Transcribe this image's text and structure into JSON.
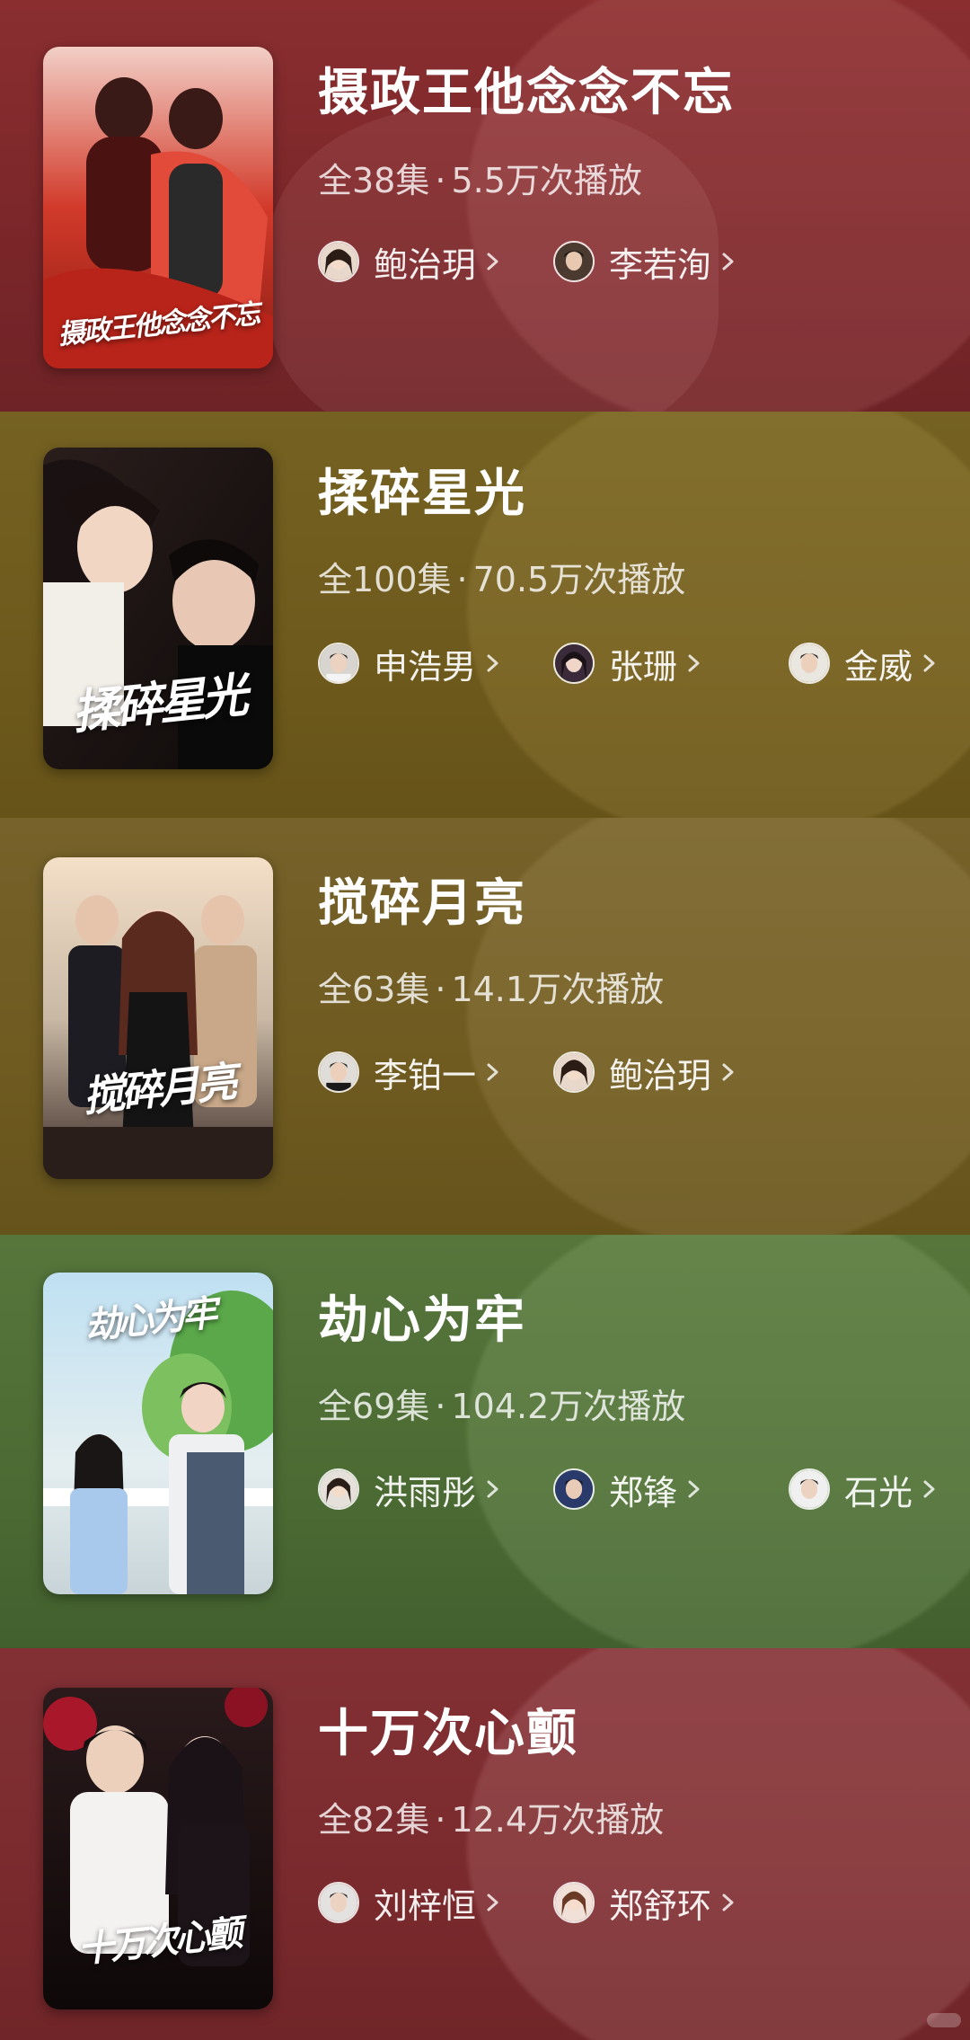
{
  "dramas": [
    {
      "title": "摄政王他念念不忘",
      "episodes": "全38集",
      "separator": "·",
      "plays": "5.5万次播放",
      "poster_text": "摄政王他念念不忘",
      "bg_color": "#7d2a2c",
      "actors": [
        {
          "name": "鲍治玥"
        },
        {
          "name": "李若洵"
        }
      ]
    },
    {
      "title": "揉碎星光",
      "episodes": "全100集",
      "separator": "·",
      "plays": "70.5万次播放",
      "poster_text": "揉碎星光",
      "bg_color": "#6e5a1c",
      "actors": [
        {
          "name": "申浩男"
        },
        {
          "name": "张珊"
        },
        {
          "name": "金威"
        }
      ]
    },
    {
      "title": "搅碎月亮",
      "episodes": "全63集",
      "separator": "·",
      "plays": "14.1万次播放",
      "poster_text": "搅碎月亮",
      "bg_color": "#6f5b20",
      "actors": [
        {
          "name": "李铂一"
        },
        {
          "name": "鲍治玥"
        }
      ]
    },
    {
      "title": "劫心为牢",
      "episodes": "全69集",
      "separator": "·",
      "plays": "104.2万次播放",
      "poster_text": "劫心为牢",
      "bg_color": "#4c6b34",
      "actors": [
        {
          "name": "洪雨彤"
        },
        {
          "name": "郑锋"
        },
        {
          "name": "石光"
        }
      ]
    },
    {
      "title": "十万次心颤",
      "episodes": "全82集",
      "separator": "·",
      "plays": "12.4万次播放",
      "poster_text": "十万次心颤",
      "bg_color": "#7a2a2d",
      "actors": [
        {
          "name": "刘梓恒"
        },
        {
          "name": "郑舒环"
        }
      ]
    }
  ]
}
